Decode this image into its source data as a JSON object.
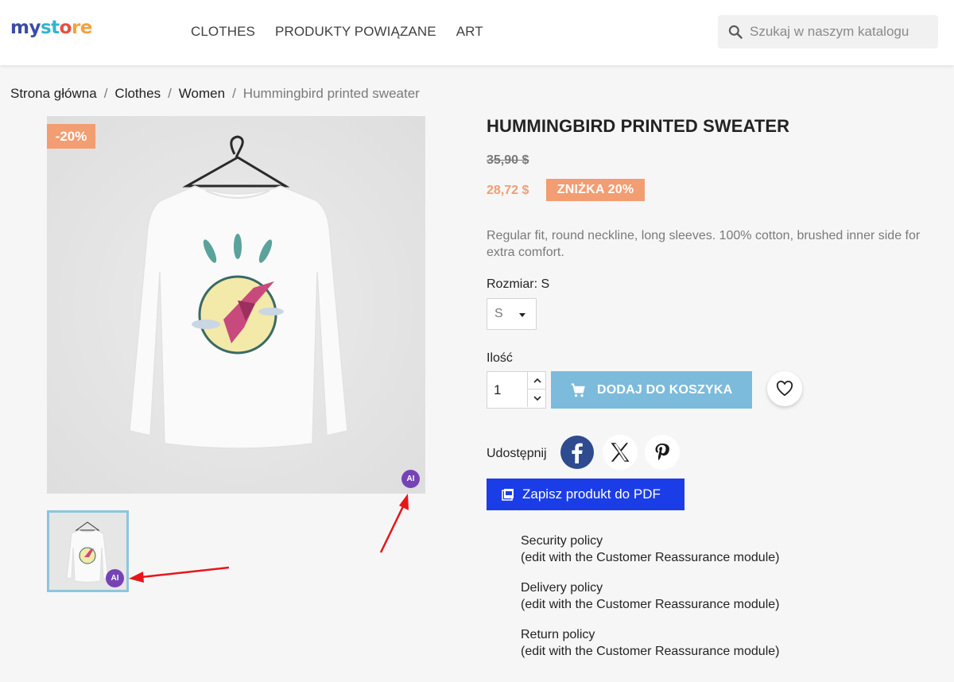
{
  "header": {
    "logo": {
      "part1": "my",
      "part2": "st",
      "part3": "o",
      "part4": "re"
    },
    "nav": [
      "CLOTHES",
      "PRODUKTY POWIĄZANE",
      "ART"
    ],
    "search": {
      "placeholder": "Szukaj w naszym katalogu",
      "icon": "search-icon"
    }
  },
  "breadcrumb": {
    "items": [
      "Strona główna",
      "Clothes",
      "Women"
    ],
    "current": "Hummingbird printed sweater",
    "separator": "/"
  },
  "gallery": {
    "discount_flag": "-20%",
    "ai_badge": "AI",
    "thumb_ai_badge": "AI"
  },
  "product": {
    "title": "HUMMINGBIRD PRINTED SWEATER",
    "old_price": "35,90 $",
    "price": "28,72 $",
    "discount_badge": "ZNIŻKA 20%",
    "description": "Regular fit, round neckline, long sleeves. 100% cotton, brushed inner side for extra comfort.",
    "size_label": "Rozmiar: S",
    "size_value": "S",
    "qty_label": "Ilość",
    "qty_value": "1",
    "add_to_cart": "DODAJ DO KOSZYKA",
    "share_label": "Udostępnij",
    "pdf_button": "Zapisz produkt do PDF"
  },
  "reassurance": [
    {
      "title": "Security policy",
      "note": "(edit with the Customer Reassurance module)"
    },
    {
      "title": "Delivery policy",
      "note": "(edit with the Customer Reassurance module)"
    },
    {
      "title": "Return policy",
      "note": "(edit with the Customer Reassurance module)"
    }
  ],
  "colors": {
    "accent": "#7cbbdb",
    "discount": "#f39d72",
    "pdf_button": "#1b3de8",
    "ai_badge": "#7643b5",
    "annotation_arrow": "#e8161b"
  }
}
